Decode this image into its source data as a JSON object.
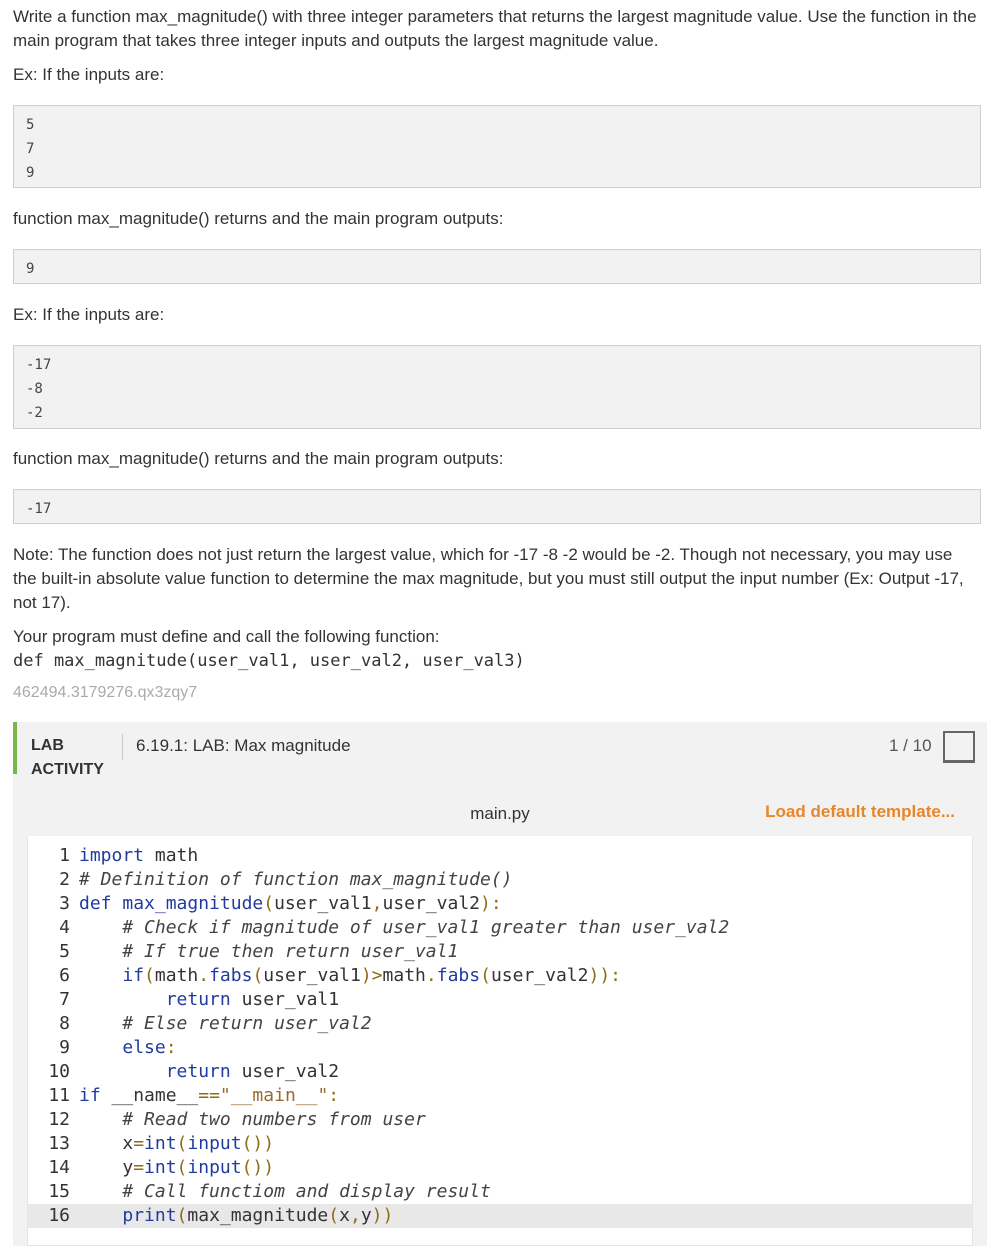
{
  "intro": "Write a function max_magnitude() with three integer parameters that returns the largest magnitude value. Use the function in the main program that takes three integer inputs and outputs the largest magnitude value.",
  "ex1_label": "Ex: If the inputs are:",
  "ex1_inputs": [
    "5",
    "7",
    "9"
  ],
  "ex1_out_label": "function max_magnitude() returns and the main program outputs:",
  "ex1_output": "9",
  "ex2_label": "Ex: If the inputs are:",
  "ex2_inputs": [
    "-17",
    "-8",
    "-2"
  ],
  "ex2_out_label": "function max_magnitude() returns and the main program outputs:",
  "ex2_output": "-17",
  "note": "Note: The function does not just return the largest value, which for -17 -8 -2 would be -2. Though not necessary, you may use the built-in absolute value function to determine the max magnitude, but you must still output the input number (Ex: Output -17, not 17).",
  "must_define": "Your program must define and call the following function:",
  "signature": "def max_magnitude(user_val1, user_val2, user_val3)",
  "ref_id": "462494.3179276.qx3zqy7",
  "lab": {
    "tag": "LAB ACTIVITY",
    "title": "6.19.1: LAB: Max magnitude",
    "score": "1 / 10"
  },
  "editor": {
    "filename": "main.py",
    "load_label": "Load default template...",
    "lines": [
      "import math",
      "# Definition of function max_magnitude()",
      "def max_magnitude(user_val1,user_val2):",
      "    # Check if magnitude of user_val1 greater than user_val2",
      "    # If true then return user_val1",
      "    if(math.fabs(user_val1)>math.fabs(user_val2)):",
      "        return user_val1",
      "    # Else return user_val2",
      "    else:",
      "        return user_val2",
      "if __name__==\"__main__\":",
      "    # Read two numbers from user",
      "    x=int(input())",
      "    y=int(input())",
      "    # Call functiom and display result",
      "    print(max_magnitude(x,y))"
    ]
  },
  "colors": {
    "accent_green": "#7ab648",
    "load_link": "#e8862a",
    "keyword": "#1f3c9e"
  }
}
